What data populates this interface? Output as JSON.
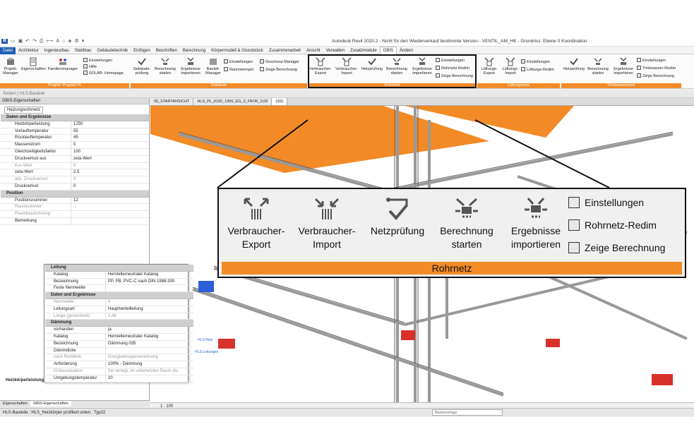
{
  "app": {
    "title": "Autodesk Revit 2020.2 - Nicht für den Wiederverkauf bestimmte Version - VENTIL_AM_HK - Grundriss: Ebene 0 Koordination",
    "logo": "R"
  },
  "tabs": [
    "Datei",
    "Architektur",
    "Ingenieurbau",
    "Stahlbau",
    "Gebäudetechnik",
    "Einfügen",
    "Beschriften",
    "Berechnung",
    "Körpermodell & Grundstück",
    "Zusammenarbeit",
    "Ansicht",
    "Verwalten",
    "Zusatzmodule",
    "GBIS",
    "Ändern"
  ],
  "ribbon": {
    "projekt": {
      "buttons": [
        "Projekt-Manager",
        "Eigenschaften",
        "Familienmanager"
      ],
      "small": [
        "Einstellungen",
        "Hilfe",
        "SOLAR- Homepage"
      ],
      "panel": "Projekt: Projekt174"
    },
    "gebaeude": {
      "buttons": [
        "Gebäude-prüfung",
        "Berechnung starten",
        "Ergebnisse importieren",
        "Bauteil-Manager"
      ],
      "small": [
        "Einstellungen",
        "Raumstempel",
        "Geschoss-Manager",
        "Zeige Berechnung"
      ],
      "panel": "Gebäude"
    },
    "rohrnetz": {
      "buttons": [
        "Verbraucher-Export",
        "Verbraucher-Import",
        "Netzprüfung",
        "Berechnung starten",
        "Ergebnisse importieren"
      ],
      "small": [
        "Einstellungen",
        "Rohrnetz-Redim",
        "Zeige Berechnung"
      ],
      "panel": "Rohrnetz"
    },
    "lueftungsnetz": {
      "buttons": [
        "Lüftungs-Export",
        "Lüftungs-Import"
      ],
      "small": [
        "Einstellungen",
        "Lüftungs-Redim"
      ],
      "panel": "Lüftungsnetz"
    },
    "trinkwasser": {
      "buttons": [
        "Netzprüfung",
        "Berechnung starten",
        "Ergebnisse importieren"
      ],
      "small": [
        "Einstellungen",
        "Trinkwasser-Redim",
        "Zeige Berechnung"
      ],
      "panel": "Trinkwassernetz"
    }
  },
  "pathbar": "Ändern | HLS-Bauteile",
  "properties": {
    "header": "GBIS-Eigenschaften",
    "type": "Heizungsrohrnetz",
    "groups": [
      {
        "name": "Daten und Ergebnisse",
        "rows": [
          {
            "k": "Heizkörperleistung",
            "v": "1250"
          },
          {
            "k": "Vorlauftemperatur",
            "v": "55"
          },
          {
            "k": "Rücklauftemperatur",
            "v": "45"
          },
          {
            "k": "Massenstrom",
            "v": "0"
          },
          {
            "k": "Gleichzeitigkeitsfaktor",
            "v": "100"
          },
          {
            "k": "Druckverlust aus",
            "v": "zeta-Wert"
          },
          {
            "k": "Kvs-Wert",
            "v": "0",
            "dis": true
          },
          {
            "k": "zeta-Wert",
            "v": "2,5"
          },
          {
            "k": "abs. Druckverlust",
            "v": "0",
            "dis": true
          },
          {
            "k": "Druckverlust",
            "v": "0"
          }
        ]
      },
      {
        "name": "Position",
        "rows": [
          {
            "k": "Positionsnummer",
            "v": "12"
          },
          {
            "k": "Raumnummer",
            "v": "",
            "dis": true
          },
          {
            "k": "Raumbezeichnung",
            "v": "",
            "dis": true
          },
          {
            "k": "Bemerkung",
            "v": ""
          }
        ]
      }
    ],
    "bottom_label": "Heizkörperleistung",
    "bottom_tabs": [
      "Eigenschaften",
      "GBIS-Eigenschaften"
    ]
  },
  "floating": {
    "groups": [
      {
        "name": "Leitung",
        "rows": [
          {
            "k": "Katalog",
            "v": "Herstellerneutraler Katalog"
          },
          {
            "k": "Bezeichnung",
            "v": "PP, PB, PVC-C nach DIN 1988-300"
          },
          {
            "k": "Feste Nennweite",
            "v": ""
          }
        ]
      },
      {
        "name": "Daten und Ergebnisse",
        "rows": [
          {
            "k": "Nennweite",
            "v": "0",
            "dis": true
          },
          {
            "k": "Leitungsart",
            "v": "Hauptverteilleitung"
          },
          {
            "k": "Länge (gezeichnet)",
            "v": "2,46",
            "dis": true
          }
        ]
      },
      {
        "name": "Dämmung",
        "rows": [
          {
            "k": "vorhanden",
            "v": "ja"
          },
          {
            "k": "Katalog",
            "v": "Herstellerneutraler Katalog"
          },
          {
            "k": "Bezeichnung",
            "v": "Dämmung 035"
          },
          {
            "k": "Dämmdicke",
            "v": ""
          },
          {
            "k": "nach Richtlinie",
            "v": "Energieeinsparverordnung",
            "dis": true
          },
          {
            "k": "Anforderung",
            "v": "100% - Dämmung"
          },
          {
            "k": "Einbausituation",
            "v": "frei verlegt, im unbeheizten Raum (tu-",
            "dis": true
          },
          {
            "k": "Umgebungstemperatur",
            "v": "20"
          }
        ]
      }
    ]
  },
  "view_tabs": [
    "00_STARTANSICHT",
    "HLS_PL_KOO_1000_EG_0_FBOK_0,00",
    "{3D}"
  ],
  "view": {
    "scale": "1 : 100",
    "tag1": "HLS-Heiz",
    "tag2": "HLS-Leitungen"
  },
  "status": {
    "text": "HLS-Bauteile : HLS_Heizkörper profiliert unten : Typ22",
    "base": "Basisvorlage"
  },
  "zoom": {
    "buttons": [
      "Verbraucher-Export",
      "Verbraucher-Import",
      "Netzprüfung",
      "Berechnung starten",
      "Ergebnisse importieren"
    ],
    "small": [
      "Einstellungen",
      "Rohrnetz-Redim",
      "Zeige Berechnung"
    ],
    "panel": "Rohrnetz"
  },
  "colors": {
    "accent": "#f28a26",
    "file_tab": "#1f5fb2",
    "radiator": "#d8312a",
    "pipe_blue": "#2b5fd8"
  }
}
